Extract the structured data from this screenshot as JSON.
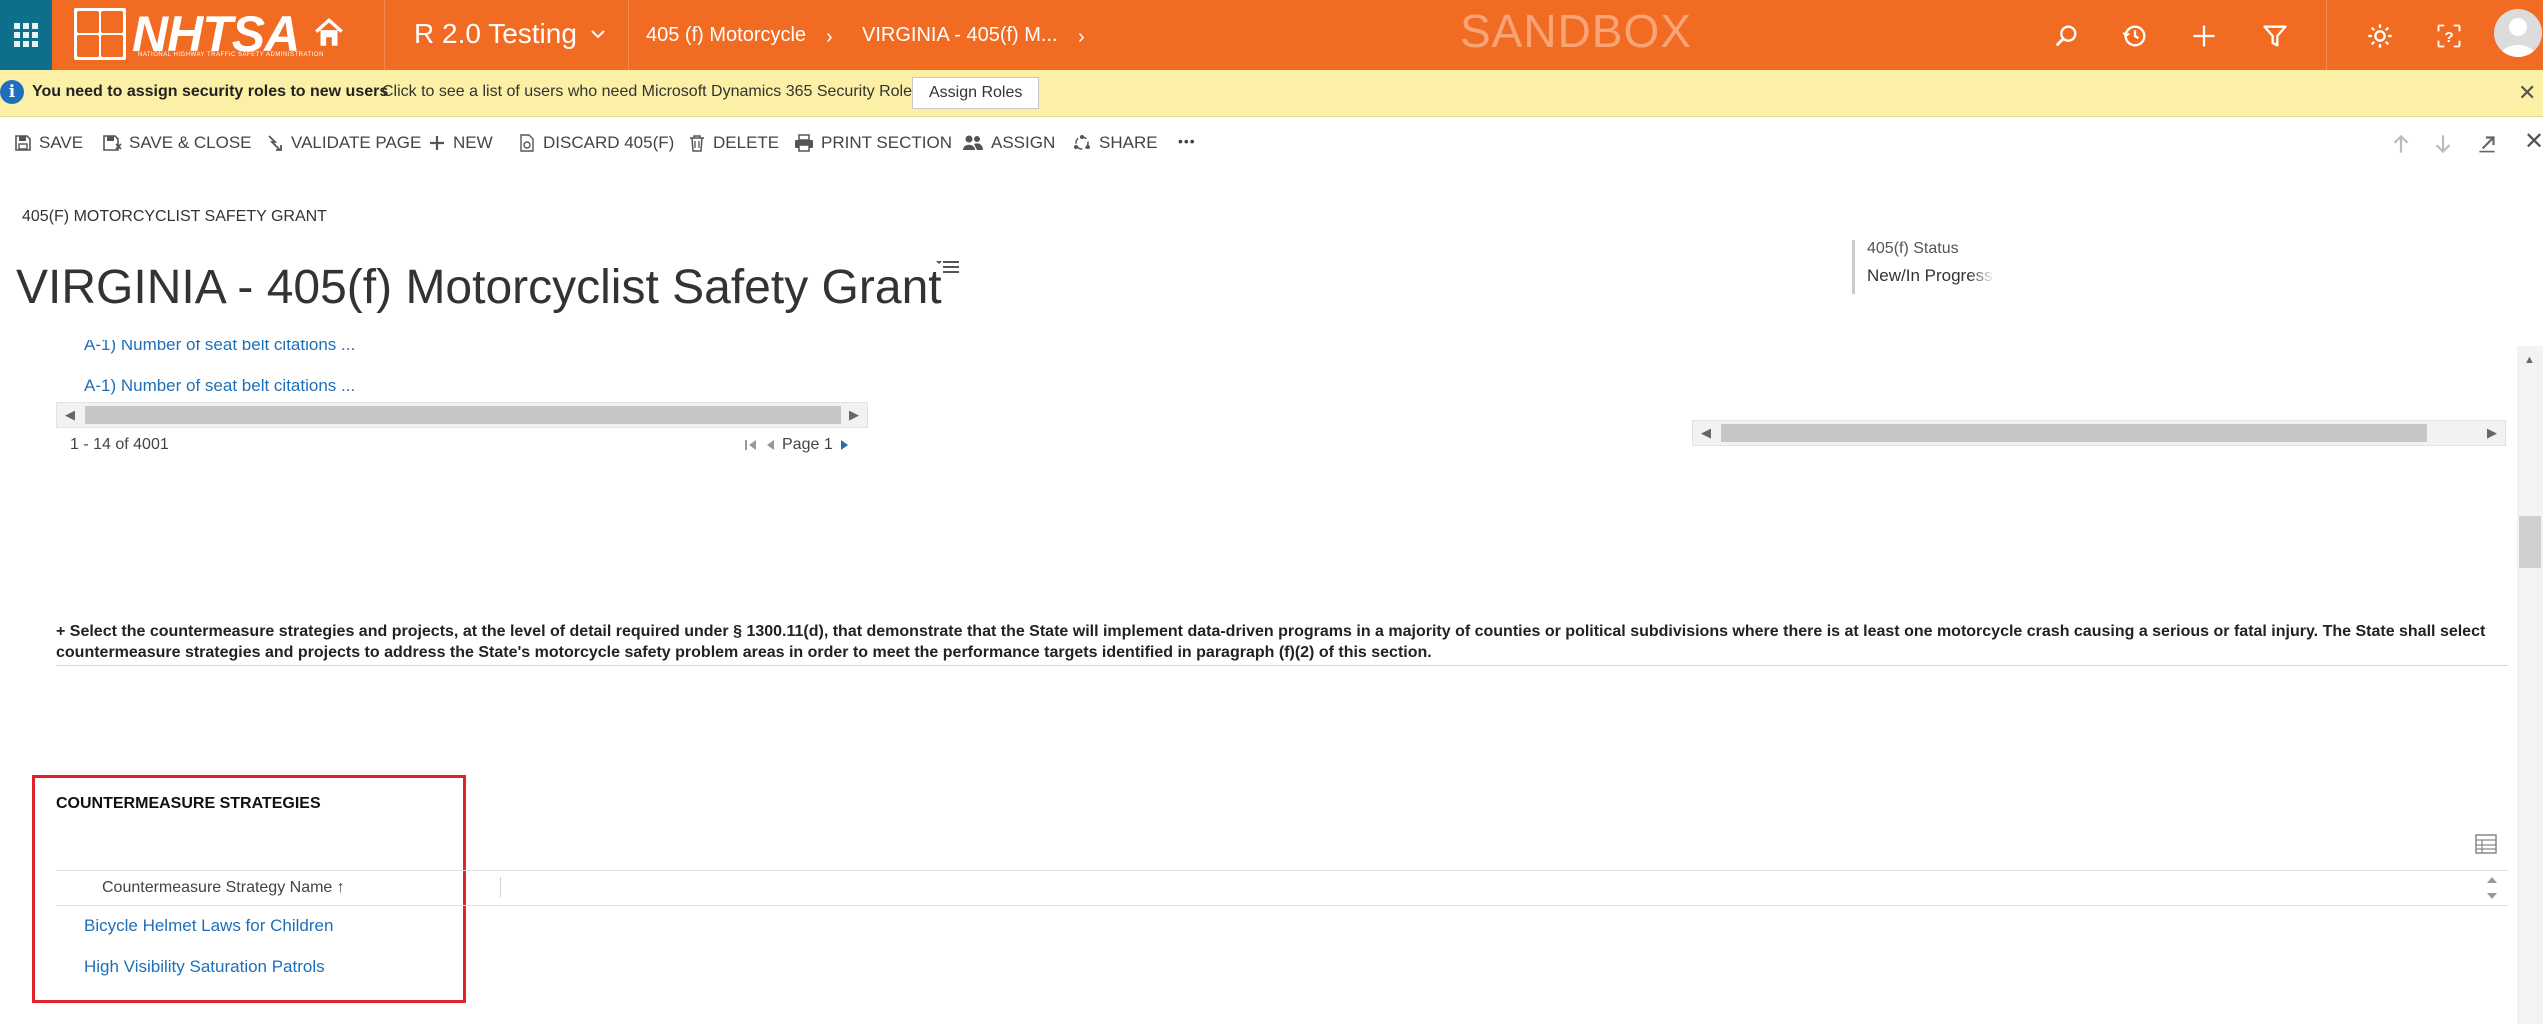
{
  "nav": {
    "logo_text": "NHTSA",
    "logo_subtext": "NATIONAL HIGHWAY TRAFFIC SAFETY ADMINISTRATION",
    "app_name": "R 2.0 Testing",
    "breadcrumbs": [
      "405 (f) Motorcycle",
      "VIRGINIA - 405(f) M..."
    ],
    "environment_label": "SANDBOX",
    "colors": {
      "bar": "#f26b22",
      "waffle": "#0f6f8a"
    }
  },
  "notification": {
    "title": "You need to assign security roles to new users",
    "message": "Click to see a list of users who need Microsoft Dynamics 365 Security Roles.",
    "button_label": "Assign Roles",
    "close_glyph": "✕"
  },
  "commands": {
    "save": "SAVE",
    "save_close": "SAVE & CLOSE",
    "validate_page": "VALIDATE PAGE",
    "new": "NEW",
    "discard": "DISCARD 405(F)",
    "delete": "DELETE",
    "print_section": "PRINT SECTION",
    "assign": "ASSIGN",
    "share": "SHARE",
    "more": "•••",
    "close": "✕"
  },
  "header": {
    "entity_label": "405(F) MOTORCYCLIST SAFETY GRANT",
    "record_title": "VIRGINIA - 405(f) Motorcyclist Safety Grant",
    "status_label": "405(f) Status",
    "status_value": "New/In Progress"
  },
  "subgrid": {
    "rows": [
      "A-1) Number of seat belt citations ...",
      "A-1) Number of seat belt citations ..."
    ],
    "record_count": "1 - 14 of 4001",
    "page_label": "Page 1"
  },
  "instructions": "+ Select the countermeasure strategies and projects, at the level of detail required under § 1300.11(d), that demonstrate that the State will implement data-driven programs in a majority of counties or political subdivisions where there is at least one motorcycle crash causing a serious or fatal injury. The State shall select countermeasure strategies and projects to address the State's motorcycle safety problem areas in order to meet the performance targets identified in paragraph (f)(2) of this section.",
  "countermeasures": {
    "section_title": "COUNTERMEASURE STRATEGIES",
    "column_header": "Countermeasure Strategy Name",
    "sort_glyph": "↑",
    "rows": [
      "Bicycle Helmet Laws for Children",
      "High Visibility Saturation Patrols"
    ],
    "highlight_color": "#e0232a"
  }
}
